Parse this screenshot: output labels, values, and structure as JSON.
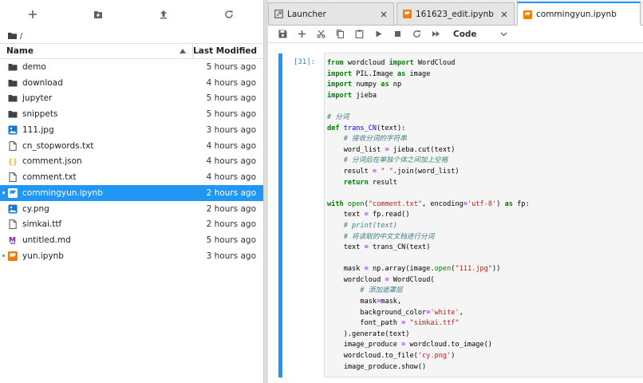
{
  "file_browser": {
    "toolbar": [
      {
        "name": "new-launcher-button",
        "icon": "plus-icon"
      },
      {
        "name": "new-folder-button",
        "icon": "folder-plus-icon"
      },
      {
        "name": "upload-button",
        "icon": "upload-icon"
      },
      {
        "name": "refresh-button",
        "icon": "refresh-icon"
      }
    ],
    "breadcrumb": "/",
    "header": {
      "name": "Name",
      "modified": "Last Modified"
    },
    "files": [
      {
        "name": "demo",
        "modified": "5 hours ago",
        "type": "folder"
      },
      {
        "name": "download",
        "modified": "4 hours ago",
        "type": "folder"
      },
      {
        "name": "jupyter",
        "modified": "5 hours ago",
        "type": "folder"
      },
      {
        "name": "snippets",
        "modified": "5 hours ago",
        "type": "folder"
      },
      {
        "name": "111.jpg",
        "modified": "3 hours ago",
        "type": "image"
      },
      {
        "name": "cn_stopwords.txt",
        "modified": "4 hours ago",
        "type": "text"
      },
      {
        "name": "comment.json",
        "modified": "4 hours ago",
        "type": "json"
      },
      {
        "name": "comment.txt",
        "modified": "4 hours ago",
        "type": "text"
      },
      {
        "name": "commingyun.ipynb",
        "modified": "2 hours ago",
        "type": "notebook",
        "selected": true,
        "running": true
      },
      {
        "name": "cy.png",
        "modified": "2 hours ago",
        "type": "image"
      },
      {
        "name": "simkai.ttf",
        "modified": "2 hours ago",
        "type": "text"
      },
      {
        "name": "untitled.md",
        "modified": "5 hours ago",
        "type": "markdown"
      },
      {
        "name": "yun.ipynb",
        "modified": "3 hours ago",
        "type": "notebook",
        "running": true
      }
    ]
  },
  "tabs": [
    {
      "label": "Launcher",
      "icon": "launcher-icon"
    },
    {
      "label": "161623_edit.ipynb",
      "icon": "notebook-icon"
    },
    {
      "label": "commingyun.ipynb",
      "icon": "notebook-icon",
      "active": true
    }
  ],
  "notebook_toolbar": {
    "buttons": [
      "save-icon",
      "plus-icon",
      "cut-icon",
      "copy-icon",
      "paste-icon",
      "run-icon",
      "stop-icon",
      "restart-icon",
      "fast-forward-icon"
    ],
    "cell_type": "Code"
  },
  "cell": {
    "prompt": "[31]:",
    "code": [
      "from wordcloud import WordCloud",
      "import PIL.Image as image",
      "import numpy as np",
      "import jieba",
      "",
      "# 分词",
      "def trans_CN(text):",
      "    # 接收分词的字符串",
      "    word_list = jieba.cut(text)",
      "    # 分词后在单独个体之间加上空格",
      "    result = \" \".join(word_list)",
      "    return result",
      "",
      "with open(\"comment.txt\", encoding='utf-8') as fp:",
      "    text = fp.read()",
      "    # print(text)",
      "    # 将读取的中文文档进行分词",
      "    text = trans_CN(text)",
      "",
      "    mask = np.array(image.open(\"111.jpg\"))",
      "    wordcloud = WordCloud(",
      "        # 添加遮罩层",
      "        mask=mask,",
      "        background_color='white',",
      "        font_path = \"simkai.ttf\"",
      "    ).generate(text)",
      "    image_produce = wordcloud.to_image()",
      "    wordcloud.to_file('cy.png')",
      "    image_produce.show()"
    ]
  },
  "colors": {
    "accent": "#2196f3",
    "selected_row": "#2196f3",
    "running_dot": "#4caf50",
    "notebook_icon": "#f57c00"
  }
}
